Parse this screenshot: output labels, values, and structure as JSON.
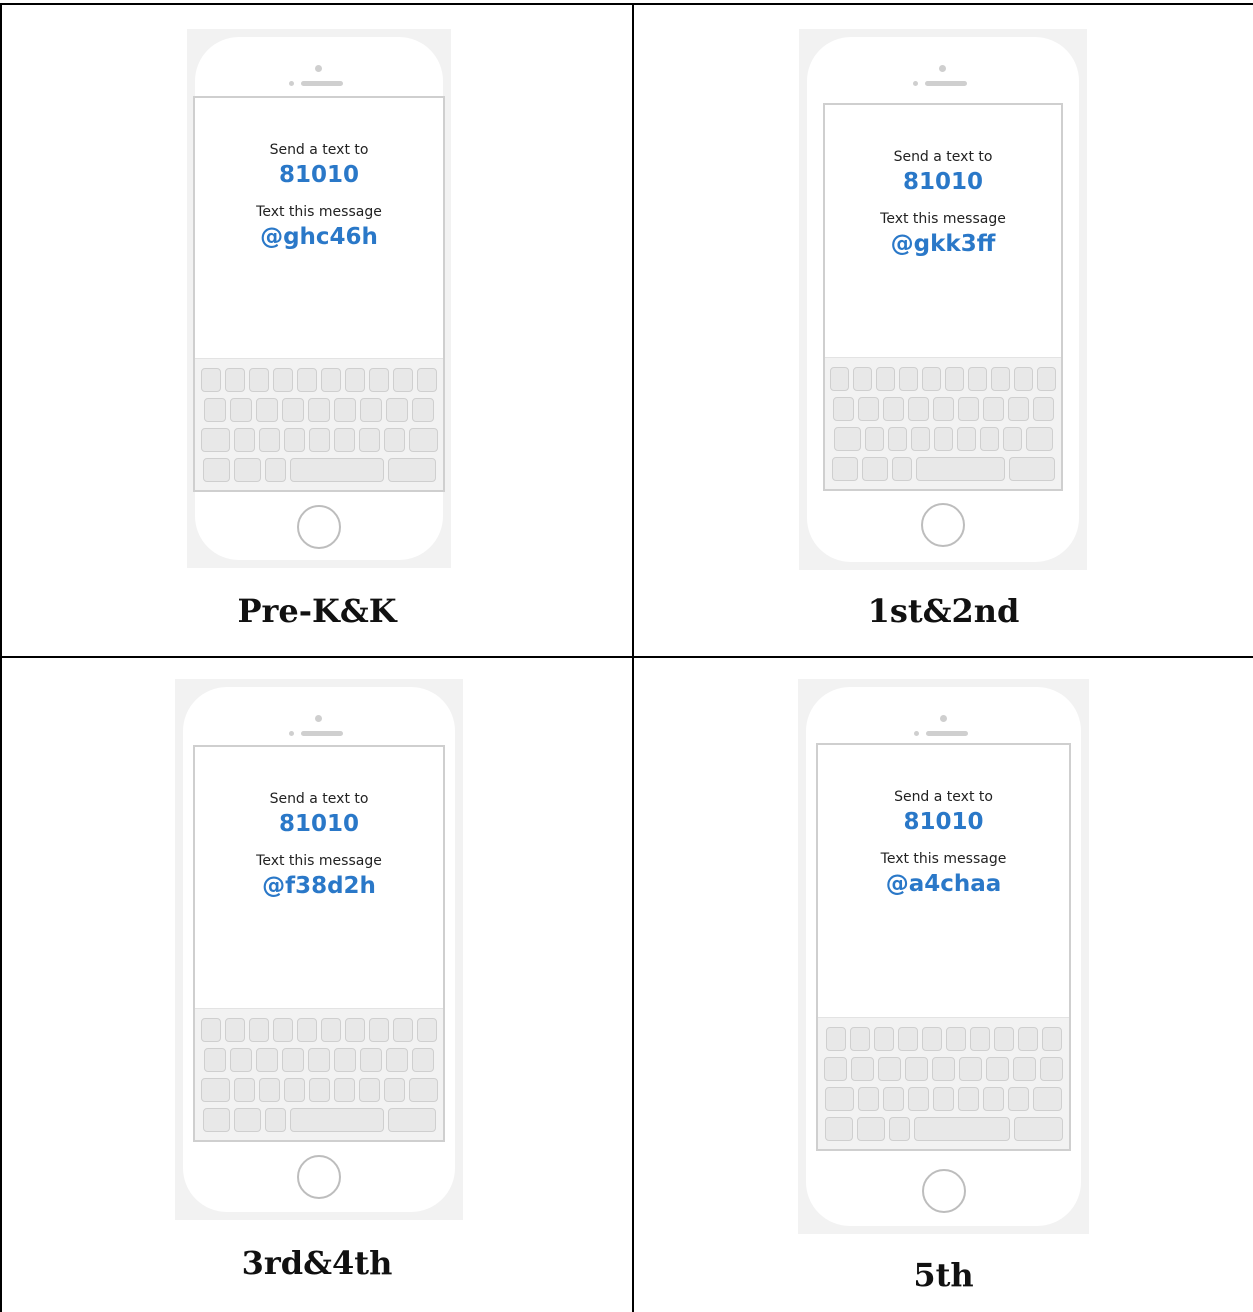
{
  "panels": [
    {
      "caption": "Pre-K&K",
      "send_label": "Send a text to",
      "number": "81010",
      "message_label": "Text this message",
      "code": "@ghc46h"
    },
    {
      "caption": "1st&2nd",
      "send_label": "Send a text to",
      "number": "81010",
      "message_label": "Text this message",
      "code": "@gkk3ff"
    },
    {
      "caption": "3rd&4th",
      "send_label": "Send a text to",
      "number": "81010",
      "message_label": "Text this message",
      "code": "@f38d2h"
    },
    {
      "caption": "5th",
      "send_label": "Send a text to",
      "number": "81010",
      "message_label": "Text this message",
      "code": "@a4chaa"
    }
  ],
  "colors": {
    "accent": "#2a78c8",
    "phone_frame": "#f2f2f2",
    "key": "#e8e8e8",
    "border": "#000000"
  }
}
